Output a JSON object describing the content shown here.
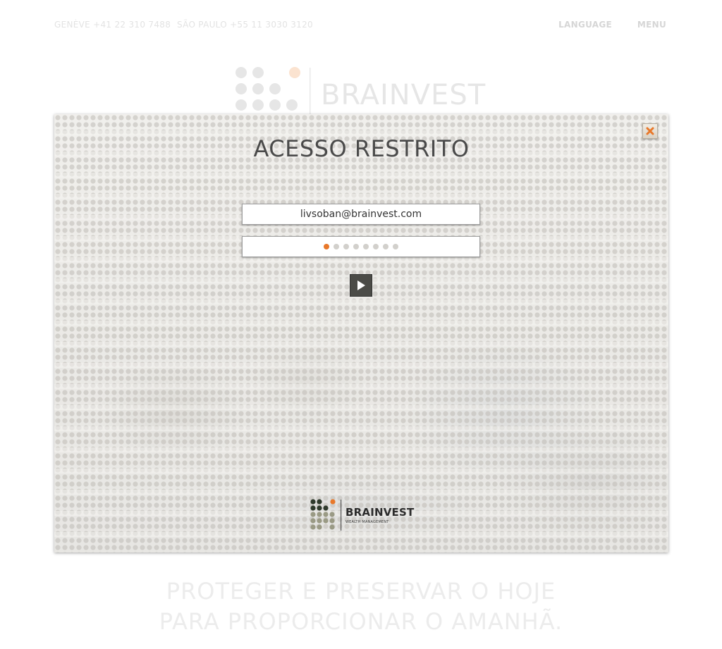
{
  "header": {
    "contacts": [
      {
        "label": "GENÈVE +41 22 310 7488"
      },
      {
        "label": "SÃO PAULO +55 11 3030 3120"
      }
    ],
    "language_label": "LANGUAGE",
    "menu_label": "MENU"
  },
  "brand": {
    "name": "BRAINVEST",
    "subtitle": "WEALTH MANAGEMENT",
    "accent_color": "#e8782a"
  },
  "tagline": {
    "line1": "PROTEGER E PRESERVAR O HOJE",
    "line2": "PARA PROPORCIONAR O AMANHÃ."
  },
  "login_modal": {
    "title": "ACESSO RESTRITO",
    "email_value": "livsoban@brainvest.com",
    "password_length": 8,
    "submit_icon": "play-icon",
    "close_icon": "close-icon"
  }
}
